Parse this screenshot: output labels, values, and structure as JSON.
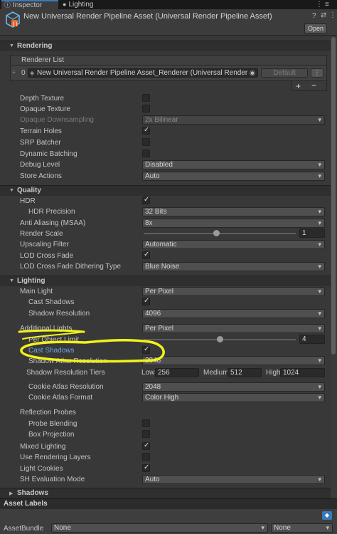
{
  "tabs": [
    {
      "label": "Inspector",
      "icon": "info-icon"
    },
    {
      "label": "Lighting",
      "icon": "lightbulb-icon"
    }
  ],
  "header": {
    "title": "New Universal Render Pipeline Asset (Universal Render Pipeline Asset)",
    "open_label": "Open"
  },
  "rendering": {
    "section_label": "Rendering",
    "renderer_list_label": "Renderer List",
    "renderer_index": "0",
    "renderer_value": "New Universal Render Pipeline Asset_Renderer (Universal Renderer D",
    "default_label": "Default",
    "add_label": "+",
    "remove_label": "−",
    "depth_texture": "Depth Texture",
    "opaque_texture": "Opaque Texture",
    "opaque_downsampling": "Opaque Downsampling",
    "opaque_downsampling_value": "2x Bilinear",
    "terrain_holes": "Terrain Holes",
    "srp_batcher": "SRP Batcher",
    "dynamic_batching": "Dynamic Batching",
    "debug_level": "Debug Level",
    "debug_level_value": "Disabled",
    "store_actions": "Store Actions",
    "store_actions_value": "Auto"
  },
  "quality": {
    "section_label": "Quality",
    "hdr": "HDR",
    "hdr_precision": "HDR Precision",
    "hdr_precision_value": "32 Bits",
    "anti_aliasing": "Anti Aliasing (MSAA)",
    "anti_aliasing_value": "8x",
    "render_scale": "Render Scale",
    "render_scale_value": "1",
    "render_scale_level": 1,
    "upscaling_filter": "Upscaling Filter",
    "upscaling_filter_value": "Automatic",
    "lod_cross_fade": "LOD Cross Fade",
    "lod_dithering": "LOD Cross Fade Dithering Type",
    "lod_dithering_value": "Blue Noise"
  },
  "lighting": {
    "section_label": "Lighting",
    "main_light": "Main Light",
    "main_light_value": "Per Pixel",
    "cast_shadows": "Cast Shadows",
    "shadow_resolution": "Shadow Resolution",
    "shadow_resolution_value": "4096",
    "additional_lights": "Additional Lights",
    "additional_lights_value": "Per Pixel",
    "per_object_limit": "Per Object Limit",
    "per_object_limit_value": "4",
    "per_object_limit_level": 0.5,
    "additional_cast_shadows": "Cast Shadows",
    "shadow_atlas_resolution": "Shadow Atlas Resolution",
    "shadow_atlas_resolution_value": "2048",
    "shadow_resolution_tiers": "Shadow Resolution Tiers",
    "tier_low_label": "Low",
    "tier_low_value": "256",
    "tier_medium_label": "Medium",
    "tier_medium_value": "512",
    "tier_high_label": "High",
    "tier_high_value": "1024",
    "cookie_atlas_resolution": "Cookie Atlas Resolution",
    "cookie_atlas_resolution_value": "2048",
    "cookie_atlas_format": "Cookie Atlas Format",
    "cookie_atlas_format_value": "Color High",
    "reflection_probes": "Reflection Probes",
    "probe_blending": "Probe Blending",
    "box_projection": "Box Projection",
    "mixed_lighting": "Mixed Lighting",
    "use_rendering_layers": "Use Rendering Layers",
    "light_cookies": "Light Cookies",
    "sh_evaluation_mode": "SH Evaluation Mode",
    "sh_evaluation_mode_value": "Auto"
  },
  "shadows": {
    "section_label": "Shadows"
  },
  "asset_labels": {
    "title": "Asset Labels",
    "asset_bundle_label": "AssetBundle",
    "asset_bundle_value": "None",
    "asset_bundle_variant": "None"
  },
  "colors": {
    "highlight": "#f2f21a",
    "accent": "#3a79bb"
  }
}
